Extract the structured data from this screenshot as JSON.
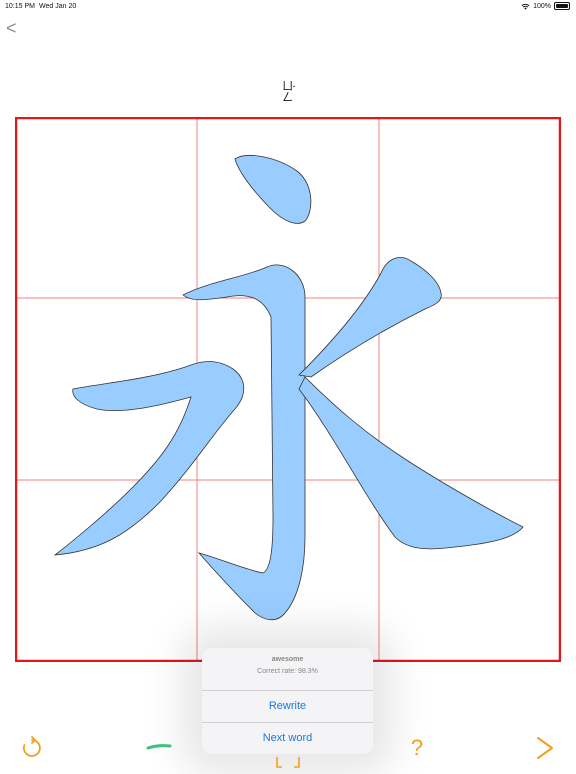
{
  "status_bar": {
    "time": "10:15 PM",
    "date": "Wed Jan 20",
    "battery": "100%"
  },
  "nav": {
    "back_label": "<"
  },
  "phonetic": {
    "symbols": "ㄩㄥ",
    "tone": "ˇ"
  },
  "character": "永",
  "popup": {
    "title": "awesome",
    "correct_rate": "Correct rate: 98.3%",
    "rewrite_label": "Rewrite",
    "next_word_label": "Next word"
  },
  "toolbar": {
    "stroke_indicator": "—",
    "help_label": "?",
    "next_label": ">"
  },
  "colors": {
    "grid_border": "#e01818",
    "grid_lines": "#f08080",
    "stroke_fill": "#99ccff",
    "accent_orange": "#f0a020",
    "accent_green": "#40c080",
    "link_blue": "#1a78e0"
  }
}
